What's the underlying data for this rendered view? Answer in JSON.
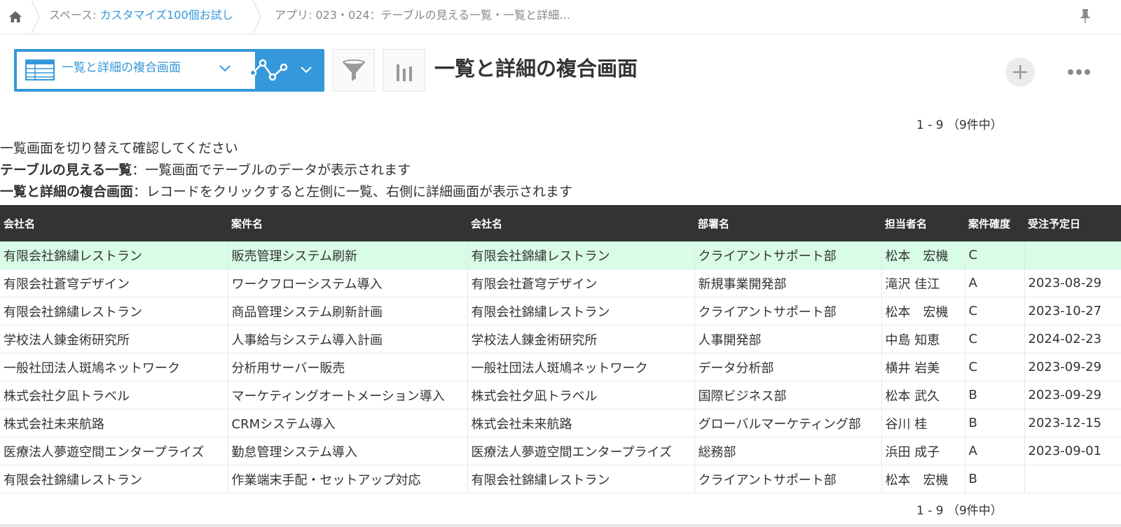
{
  "breadcrumb": {
    "space_prefix": "スペース: ",
    "space_name": "カスタマイズ100個お試し",
    "app": "アプリ: 023・024：テーブルの見える一覧・一覧と詳細…"
  },
  "view": {
    "selected": "一覧と詳細の複合画面",
    "title": "一覧と詳細の複合画面"
  },
  "pager": {
    "range": "1 - 9",
    "total": "（9件中）"
  },
  "description": {
    "line1": "一覧画面を切り替えて確認してください",
    "line2_bold": "テーブルの見える一覧",
    "line2_text": "：一覧画面でテーブルのデータが表示されます",
    "line3_bold": "一覧と詳細の複合画面",
    "line3_text": "：レコードをクリックすると左側に一覧、右側に詳細画面が表示されます"
  },
  "table": {
    "columns": [
      "会社名",
      "案件名",
      "会社名",
      "部署名",
      "担当者名",
      "案件確度",
      "受注予定日"
    ],
    "rows": [
      [
        "有限会社錦繍レストラン",
        "販売管理システム刷新",
        "有限会社錦繍レストラン",
        "クライアントサポート部",
        "松本　宏機",
        "C",
        ""
      ],
      [
        "有限会社蒼穹デザイン",
        "ワークフローシステム導入",
        "有限会社蒼穹デザイン",
        "新規事業開発部",
        "滝沢 佳江",
        "A",
        "2023-08-29"
      ],
      [
        "有限会社錦繍レストラン",
        "商品管理システム刷新計画",
        "有限会社錦繍レストラン",
        "クライアントサポート部",
        "松本　宏機",
        "C",
        "2023-10-27"
      ],
      [
        "学校法人錬金術研究所",
        "人事給与システム導入計画",
        "学校法人錬金術研究所",
        "人事開発部",
        "中島 知恵",
        "C",
        "2024-02-23"
      ],
      [
        "一般社団法人斑鳩ネットワーク",
        "分析用サーバー販売",
        "一般社団法人斑鳩ネットワーク",
        "データ分析部",
        "横井 岩美",
        "C",
        "2023-09-29"
      ],
      [
        "株式会社夕凪トラベル",
        "マーケティングオートメーション導入",
        "株式会社夕凪トラベル",
        "国際ビジネス部",
        "松本 武久",
        "B",
        "2023-09-29"
      ],
      [
        "株式会社未来航路",
        "CRMシステム導入",
        "株式会社未来航路",
        "グローバルマーケティング部",
        "谷川 桂",
        "B",
        "2023-12-15"
      ],
      [
        "医療法人夢遊空間エンタープライズ",
        "勤怠管理システム導入",
        "医療法人夢遊空間エンタープライズ",
        "総務部",
        "浜田 成子",
        "A",
        "2023-09-01"
      ],
      [
        "有限会社錦繍レストラン",
        "作業端末手配・セットアップ対応",
        "有限会社錦繍レストラン",
        "クライアントサポート部",
        "松本　宏機",
        "B",
        ""
      ]
    ]
  },
  "colors": {
    "accent": "#3498db",
    "header_bg": "#333333",
    "selected_row": "#d9fce6"
  },
  "icons": [
    "home-icon",
    "pin-icon",
    "table-view-icon",
    "chevron-down-icon",
    "graph-icon",
    "filter-icon",
    "chart-icon",
    "plus-icon",
    "more-icon"
  ]
}
